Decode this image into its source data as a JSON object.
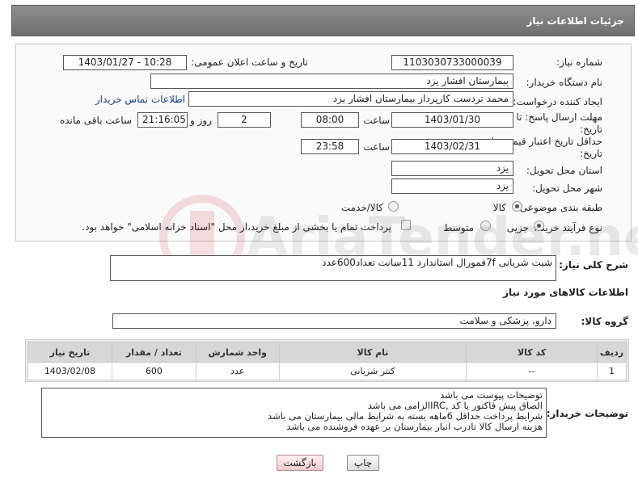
{
  "header": {
    "title": "جزئیات اطلاعات نیاز"
  },
  "form": {
    "need_number": {
      "label": "شماره نیاز:",
      "value": "1103030733000039"
    },
    "announce_datetime": {
      "label": "تاریخ و ساعت اعلان عمومی:",
      "value": "1403/01/27 - 10:28"
    },
    "buyer_org": {
      "label": "نام دستگاه خریدار:",
      "value": "بیمارستان افشار یزد"
    },
    "creator": {
      "label": "ایجاد کننده درخواست:",
      "value": "محمد تردست کارپرداز بیمارستان افشار یزد",
      "contact_link": "اطلاعات تماس خریدار"
    },
    "reply_deadline": {
      "label_line1": "مهلت ارسال پاسخ: تا",
      "label_line2": "تاریخ:",
      "date": "1403/01/30",
      "time_label": "ساعت",
      "time": "08:00",
      "days": "2",
      "days_label": "روز و",
      "remaining": "21:16:05",
      "remaining_label": "ساعت باقی مانده"
    },
    "price_validity": {
      "label_line1": "حداقل تاریخ اعتبار قیمت: تا",
      "label_line2": "تاریخ:",
      "date": "1403/02/31",
      "time_label": "ساعت",
      "time": "23:58"
    },
    "delivery_province": {
      "label": "استان محل تحویل:",
      "value": "یزد"
    },
    "delivery_city": {
      "label": "شهر محل تحویل:",
      "value": "یزد"
    },
    "category": {
      "label": "طبقه بندی موضوعی:",
      "options": [
        "کالا",
        "کالا/خدمت"
      ],
      "selected": "کالا"
    },
    "process_type": {
      "label": "نوع فرآیند خرید :",
      "options": [
        "جزیی",
        "متوسط"
      ],
      "selected": "جزیی",
      "payment_note": "پرداخت تمام یا بخشی از مبلغ خرید،از محل \"اسناد خزانه اسلامی\" خواهد بود."
    }
  },
  "general_description": {
    "label": "شرح کلی نیاز:",
    "value": "شیت شریانی 7fفمورال استاندارد 11سانت تعداد600عدد"
  },
  "goods_info": {
    "title": "اطلاعات کالاهای مورد نیاز"
  },
  "goods_group": {
    "label": "گروه کالا:",
    "value": "دارو، پزشکی و سلامت"
  },
  "items_table": {
    "columns": [
      "ردیف",
      "کد کالا",
      "نام کالا",
      "واحد شمارش",
      "تعداد / مقدار",
      "تاریخ نیاز"
    ],
    "rows": [
      {
        "row": "1",
        "code": "--",
        "name": "کتتر شریانی",
        "unit": "عدد",
        "qty": "600",
        "date": "1403/02/08"
      }
    ]
  },
  "buyer_notes": {
    "label": "توضیحات خریدار:",
    "lines": [
      "توضیحات پیوست می باشد",
      "الصاق پیش فاکتور با کد  ,IRCالزامی می باشد",
      "شرایط پرداخت   حداقل 6ماهه بسته به شرایط مالی بیمارستان می باشد",
      "هزینه ارسال کالا تادرب انبار بیمارستان بر عهده فروشنده می باشد"
    ]
  },
  "buttons": {
    "print": "چاپ",
    "back": "بازگشت"
  },
  "watermark": {
    "text": "AriaTender.net"
  }
}
